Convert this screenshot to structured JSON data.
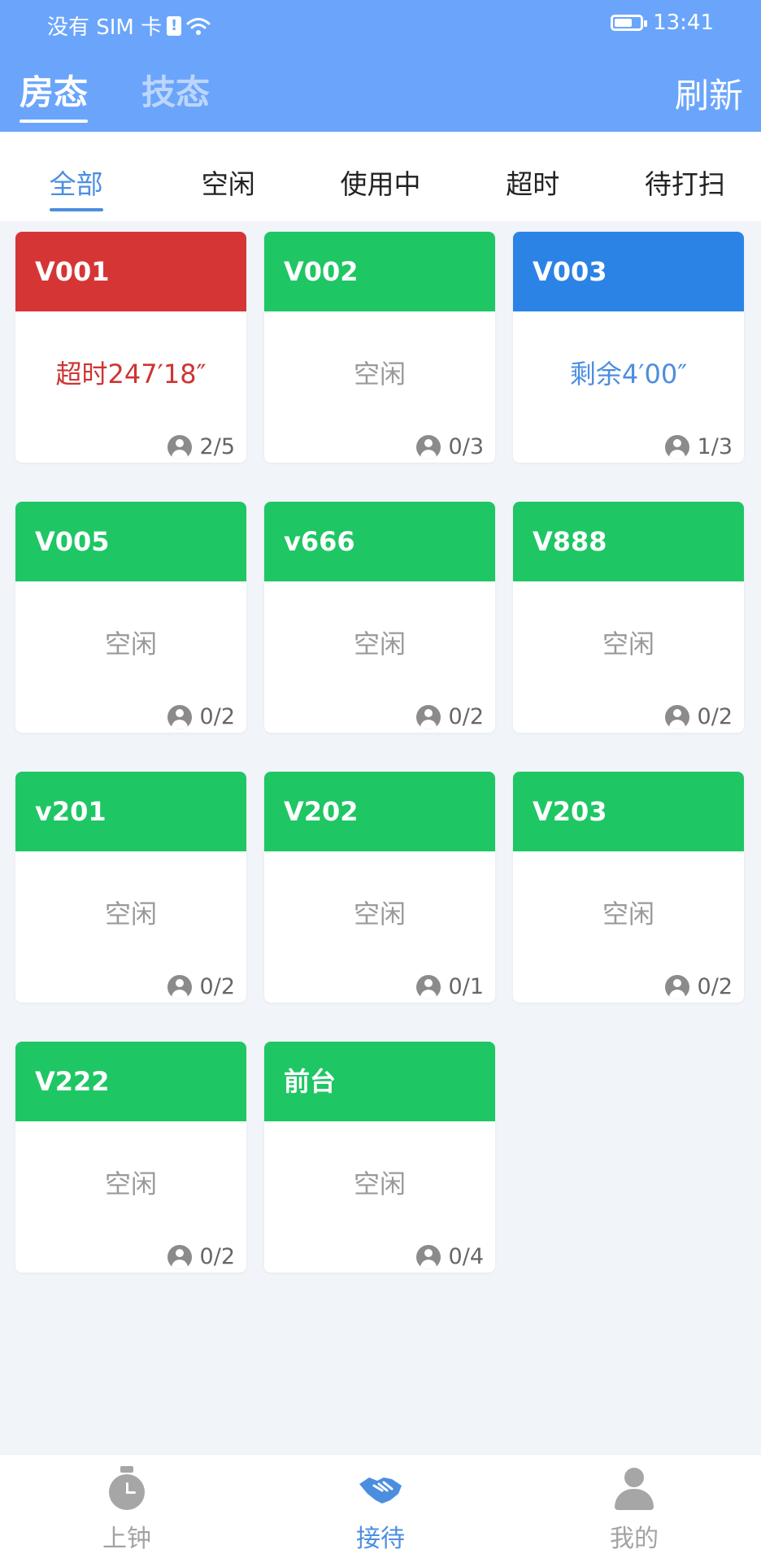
{
  "status_bar": {
    "carrier": "没有 SIM 卡",
    "time": "13:41",
    "battery_pct": 70
  },
  "header": {
    "tabs": [
      {
        "label": "房态",
        "active": true
      },
      {
        "label": "技态",
        "active": false
      }
    ],
    "refresh_label": "刷新",
    "accent_color": "#6aa5fb"
  },
  "filters": [
    {
      "label": "全部",
      "active": true
    },
    {
      "label": "空闲",
      "active": false
    },
    {
      "label": "使用中",
      "active": false
    },
    {
      "label": "超时",
      "active": false
    },
    {
      "label": "待打扫",
      "active": false
    }
  ],
  "status_colors": {
    "overtime": "#d63535",
    "idle": "#1fc664",
    "in_use": "#2b83e5"
  },
  "rooms": [
    {
      "name": "V001",
      "state": "overtime",
      "status_text": "超时247′18″",
      "occupancy": "2/5"
    },
    {
      "name": "V002",
      "state": "idle",
      "status_text": "空闲",
      "occupancy": "0/3"
    },
    {
      "name": "V003",
      "state": "in_use",
      "status_text": "剩余4′00″",
      "occupancy": "1/3"
    },
    {
      "name": "V005",
      "state": "idle",
      "status_text": "空闲",
      "occupancy": "0/2"
    },
    {
      "name": "v666",
      "state": "idle",
      "status_text": "空闲",
      "occupancy": "0/2"
    },
    {
      "name": "V888",
      "state": "idle",
      "status_text": "空闲",
      "occupancy": "0/2"
    },
    {
      "name": "v201",
      "state": "idle",
      "status_text": "空闲",
      "occupancy": "0/2"
    },
    {
      "name": "V202",
      "state": "idle",
      "status_text": "空闲",
      "occupancy": "0/1"
    },
    {
      "name": "V203",
      "state": "idle",
      "status_text": "空闲",
      "occupancy": "0/2"
    },
    {
      "name": "V222",
      "state": "idle",
      "status_text": "空闲",
      "occupancy": "0/2"
    },
    {
      "name": "前台",
      "state": "idle",
      "status_text": "空闲",
      "occupancy": "0/4"
    }
  ],
  "bottom_nav": [
    {
      "label": "上钟",
      "icon": "stopwatch-icon",
      "active": false
    },
    {
      "label": "接待",
      "icon": "handshake-icon",
      "active": true
    },
    {
      "label": "我的",
      "icon": "person-icon",
      "active": false
    }
  ]
}
